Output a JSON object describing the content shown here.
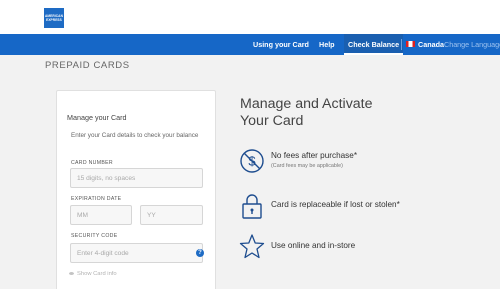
{
  "brand": {
    "logo_line1": "AMERICAN",
    "logo_line2": "EXPRESS",
    "accent": "#1667c7"
  },
  "nav": {
    "items": [
      {
        "label": "Using your Card"
      },
      {
        "label": "Help"
      },
      {
        "label": "Check Balance",
        "active": true
      }
    ],
    "country": "Canada",
    "language": "Change Language"
  },
  "page": {
    "heading": "PREPAID CARDS"
  },
  "form": {
    "title": "Manage your Card",
    "help_text": "Enter your Card details to check your balance",
    "card_number": {
      "label": "CARD NUMBER",
      "placeholder": "15 digits, no spaces"
    },
    "expiration": {
      "label": "EXPIRATION DATE",
      "month_placeholder": "MM",
      "year_placeholder": "YY"
    },
    "security": {
      "label": "SECURITY CODE",
      "placeholder": "Enter 4-digit code",
      "help_icon": "question-mark"
    },
    "show_card_info": "Show Card info"
  },
  "promo": {
    "headline": "Manage and Activate Your Card",
    "features": [
      {
        "icon": "no-fee-icon",
        "text": "No fees after purchase*",
        "subtext": "(Card fees may be applicable)"
      },
      {
        "icon": "lock-icon",
        "text": "Card is replaceable if lost or stolen*"
      },
      {
        "icon": "star-icon",
        "text": "Use online and in-store"
      }
    ]
  }
}
